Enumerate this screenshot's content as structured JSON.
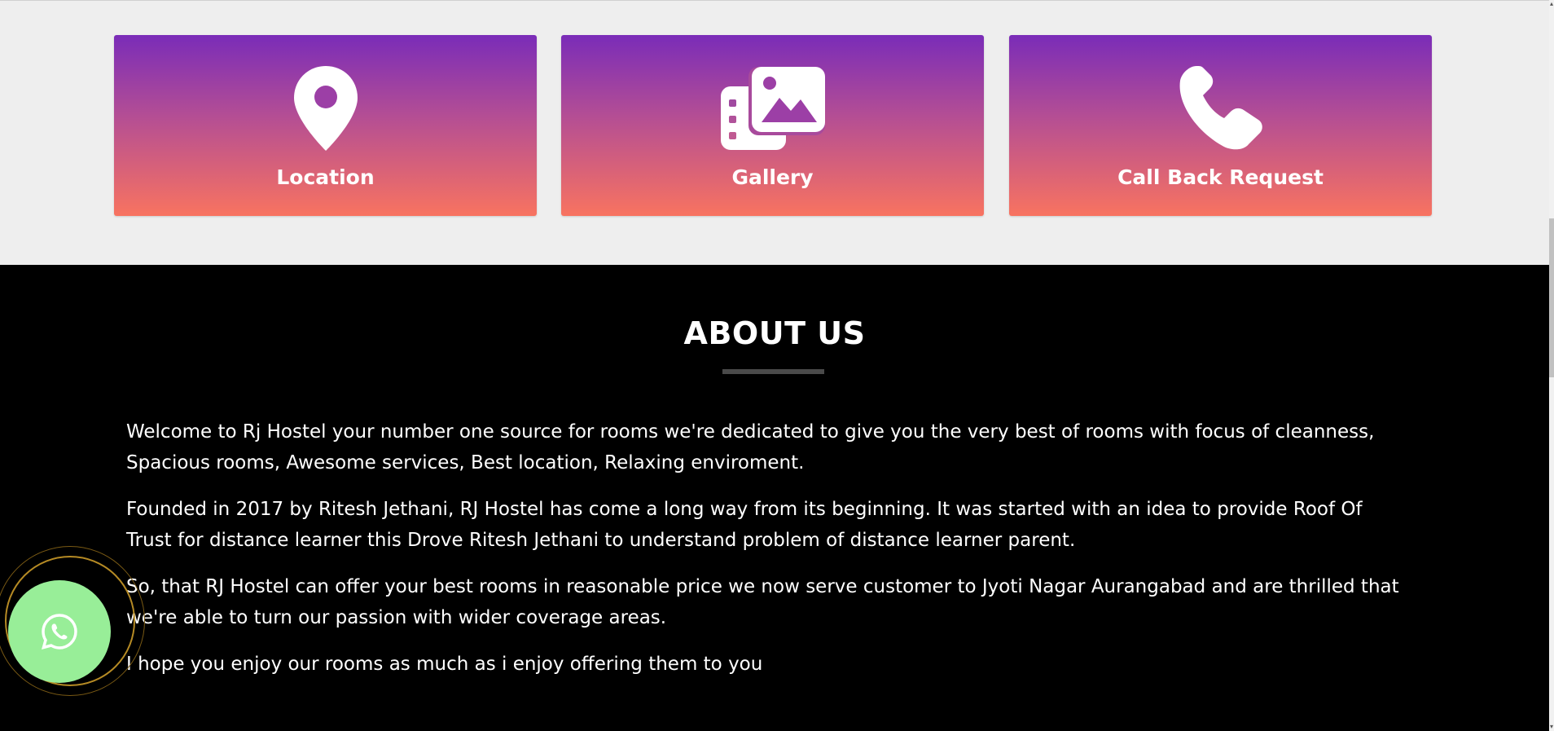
{
  "features": [
    {
      "label": "Location",
      "icon": "map-marker-icon"
    },
    {
      "label": "Gallery",
      "icon": "gallery-icon"
    },
    {
      "label": "Call Back Request",
      "icon": "phone-icon"
    }
  ],
  "about": {
    "title": "ABOUT US",
    "paragraphs": [
      "Welcome to Rj Hostel your number one source for rooms we're dedicated to give you the very best of rooms with focus of cleanness, Spacious rooms, Awesome services, Best location, Relaxing enviroment.",
      "Founded in 2017 by Ritesh Jethani, RJ Hostel has come a long way from its beginning. It was started with an idea to provide Roof Of Trust for distance learner this Drove Ritesh Jethani to understand problem of distance learner parent.",
      "So, that RJ Hostel can offer your best rooms in reasonable price we now serve customer to Jyoti Nagar Aurangabad and are thrilled that we're able to turn our passion with wider coverage areas.",
      "I hope you enjoy our rooms as much as i enjoy offering them to you"
    ]
  },
  "whatsapp": {
    "icon": "whatsapp-icon"
  },
  "colors": {
    "card_gradient_top": "#7a2cb8",
    "card_gradient_bottom": "#f87360",
    "whatsapp_green": "#98ee98",
    "about_bg": "#000000",
    "top_bg": "#eeeeee"
  }
}
